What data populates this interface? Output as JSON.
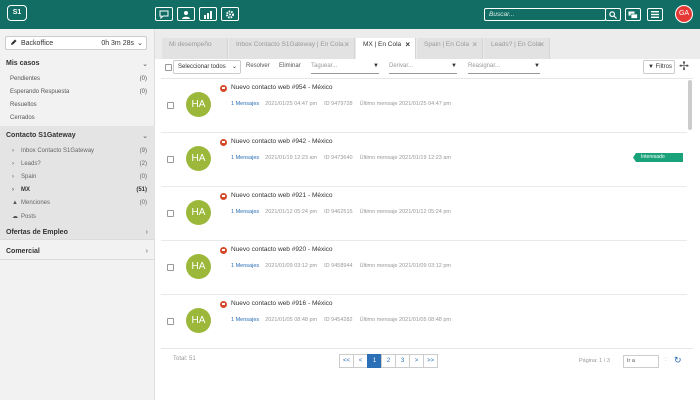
{
  "topbar": {
    "logo_text": "S1",
    "icons": [
      "chat-icon",
      "user-icon",
      "chart-icon",
      "gear-icon"
    ],
    "search_placeholder": "Buscar...",
    "user_initials": "GA",
    "color": "#126e64",
    "avatar_color": "#e53935"
  },
  "sidebar": {
    "selector_label": "Backoffice",
    "selector_time": "0h 3m 28s",
    "mis_casos": {
      "title": "Mis casos",
      "items": [
        {
          "label": "Pendientes",
          "count": "(0)"
        },
        {
          "label": "Esperando Respuesta",
          "count": "(0)"
        },
        {
          "label": "Resueltos",
          "count": ""
        },
        {
          "label": "Cerrados",
          "count": ""
        }
      ]
    },
    "contacto": {
      "title": "Contacto S1Gateway",
      "items": [
        {
          "label": "Inbox Contacto S1Gateway",
          "count": "(9)"
        },
        {
          "label": "Leads?",
          "count": "(2)"
        },
        {
          "label": "Spain",
          "count": "(0)"
        },
        {
          "label": "MX",
          "count": "(51)"
        },
        {
          "label": "Menciones",
          "count": "(0)"
        },
        {
          "label": "Posts",
          "count": ""
        }
      ]
    },
    "ofertas": {
      "title": "Ofertas de Empleo"
    },
    "comercial": {
      "title": "Comercial"
    }
  },
  "tabs": [
    {
      "label": "Mi desempeño"
    },
    {
      "label": "Inbox Contacto S1Gateway | En Cola"
    },
    {
      "label": "MX | En Cola"
    },
    {
      "label": "Spain | En Cola"
    },
    {
      "label": "Leads? | En Cola"
    }
  ],
  "toolbar": {
    "select_all": "Seleccionar todos",
    "resolver": "Resolver",
    "eliminar": "Eliminar",
    "taguear_placeholder": "Taguear...",
    "derivar_placeholder": "Derivar...",
    "reasignar_placeholder": "Reasignar...",
    "filtros": "Filtros"
  },
  "cases": [
    {
      "avatar": "HA",
      "title": "Nuevo contacto web #954 - México",
      "messages": "1 Mensajes",
      "date": "2021/01/25 04:47 pm",
      "id": "ID 9479728",
      "last": "Último mensaje 2021/01/25 04:47 pm",
      "tag": ""
    },
    {
      "avatar": "HA",
      "title": "Nuevo contacto web #942 - México",
      "messages": "1 Mensajes",
      "date": "2021/01/19 12:23 am",
      "id": "ID 9473640",
      "last": "Último mensaje 2021/01/19 12:23 am",
      "tag": "Interesado"
    },
    {
      "avatar": "HA",
      "title": "Nuevo contacto web #921 - México",
      "messages": "1 Mensajes",
      "date": "2021/01/12 05:24 pm",
      "id": "ID 9462515",
      "last": "Último mensaje 2021/01/12 05:24 pm",
      "tag": ""
    },
    {
      "avatar": "HA",
      "title": "Nuevo contacto web #920 - México",
      "messages": "1 Mensajes",
      "date": "2021/01/09 03:12 pm",
      "id": "ID 9458944",
      "last": "Último mensaje 2021/01/09 03:12 pm",
      "tag": ""
    },
    {
      "avatar": "HA",
      "title": "Nuevo contacto web #916 - México",
      "messages": "1 Mensajes",
      "date": "2021/01/05 08:48 pm",
      "id": "ID 9454282",
      "last": "Último mensaje 2021/01/05 08:48 pm",
      "tag": ""
    }
  ],
  "footer": {
    "total": "Total: 51",
    "pages": [
      "<<",
      "<",
      "1",
      "2",
      "3",
      ">",
      ">>"
    ],
    "current_page": "1",
    "page_info": "Página: 1 / 3",
    "goto_placeholder": "Ir a",
    "colon": ":"
  },
  "colors": {
    "avatar_bg": "#9bb83a",
    "tag_bg": "#1aa37a",
    "link": "#2b6fb6"
  }
}
